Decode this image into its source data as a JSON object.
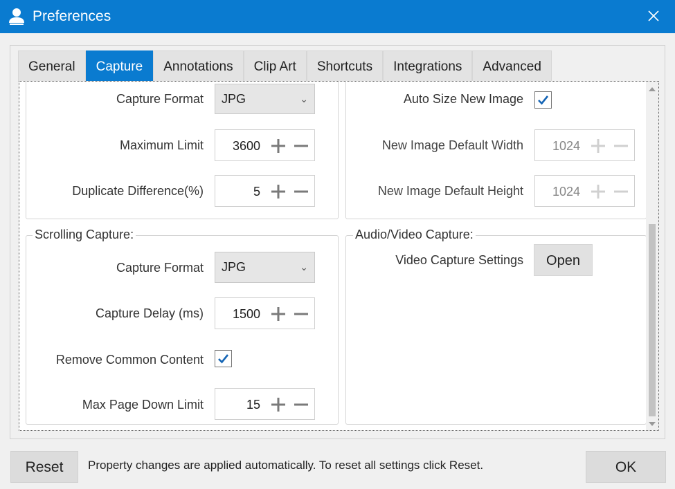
{
  "window": {
    "title": "Preferences"
  },
  "tabs": [
    {
      "label": "General"
    },
    {
      "label": "Capture"
    },
    {
      "label": "Annotations"
    },
    {
      "label": "Clip Art"
    },
    {
      "label": "Shortcuts"
    },
    {
      "label": "Integrations"
    },
    {
      "label": "Advanced"
    }
  ],
  "active_tab": "Capture",
  "capture": {
    "format_label": "Capture Format",
    "format_value": "JPG",
    "max_limit_label": "Maximum Limit",
    "max_limit_value": "3600",
    "dup_diff_label": "Duplicate Difference(%)",
    "dup_diff_value": "5"
  },
  "image": {
    "auto_size_label": "Auto Size New Image",
    "auto_size_checked": true,
    "width_label": "New Image Default Width",
    "width_value": "1024",
    "height_label": "New Image Default Height",
    "height_value": "1024"
  },
  "scrolling": {
    "group_label": "Scrolling Capture:",
    "format_label": "Capture Format",
    "format_value": "JPG",
    "delay_label": "Capture Delay (ms)",
    "delay_value": "1500",
    "remove_common_label": "Remove Common Content",
    "remove_common_checked": true,
    "max_page_label": "Max Page Down Limit",
    "max_page_value": "15"
  },
  "av": {
    "group_label": "Audio/Video Capture:",
    "settings_label": "Video Capture Settings",
    "open_label": "Open"
  },
  "footer": {
    "reset_label": "Reset",
    "message": "Property changes are applied automatically. To reset all settings click Reset.",
    "ok_label": "OK"
  },
  "colors": {
    "accent": "#0a7bd0",
    "check": "#1565b5"
  }
}
